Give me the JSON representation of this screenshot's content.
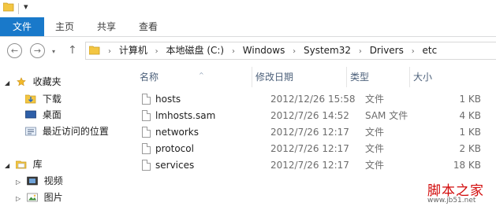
{
  "titlebar": {
    "quick_access_arrow": "▾"
  },
  "ribbon": {
    "tabs": [
      "文件",
      "主页",
      "共享",
      "查看"
    ]
  },
  "address": {
    "crumbs": [
      "计算机",
      "本地磁盘 (C:)",
      "Windows",
      "System32",
      "Drivers",
      "etc"
    ],
    "separator": "›"
  },
  "icons": {
    "back": "←",
    "forward": "→",
    "up": "↑",
    "recent": "▾"
  },
  "nav": {
    "favorites_label": "收藏夹",
    "favorites": [
      "下载",
      "桌面",
      "最近访问的位置"
    ],
    "libraries_label": "库",
    "libraries": [
      "视频",
      "图片"
    ]
  },
  "list": {
    "columns": {
      "name": "名称",
      "date": "修改日期",
      "type": "类型",
      "size": "大小"
    },
    "rows": [
      {
        "name": "hosts",
        "date": "2012/12/26 15:58",
        "type": "文件",
        "size": "1 KB"
      },
      {
        "name": "lmhosts.sam",
        "date": "2012/7/26 14:52",
        "type": "SAM 文件",
        "size": "4 KB"
      },
      {
        "name": "networks",
        "date": "2012/7/26 12:17",
        "type": "文件",
        "size": "1 KB"
      },
      {
        "name": "protocol",
        "date": "2012/7/26 12:17",
        "type": "文件",
        "size": "2 KB"
      },
      {
        "name": "services",
        "date": "2012/7/26 12:17",
        "type": "文件",
        "size": "18 KB"
      }
    ]
  },
  "watermark": {
    "title": "脚本之家",
    "url": "www.jb51.net"
  },
  "colors": {
    "file_tab": "#1979ca",
    "header_text": "#4c607a",
    "watermark": "#d20a0a"
  }
}
